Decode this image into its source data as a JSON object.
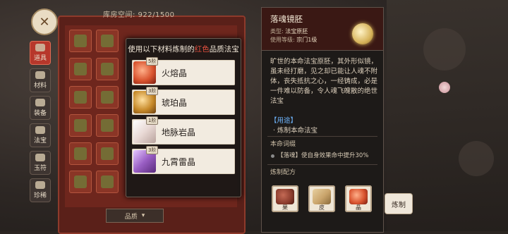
{
  "storage": {
    "label": "库房空间: 922/1500"
  },
  "nav": [
    {
      "label": "道具",
      "icon": "pouch-icon",
      "active": true
    },
    {
      "label": "材料",
      "icon": "ore-icon",
      "active": false
    },
    {
      "label": "装备",
      "icon": "armor-icon",
      "active": false
    },
    {
      "label": "法宝",
      "icon": "treasure-icon",
      "active": false
    },
    {
      "label": "玉符",
      "icon": "jade-talisman-icon",
      "active": false
    },
    {
      "label": "珍稀",
      "icon": "rare-gem-icon",
      "active": false
    }
  ],
  "bottom": {
    "quality": "品质"
  },
  "popup": {
    "title_prefix": "使用以下材料炼制的",
    "title_red": "红色",
    "title_suffix": "品质法宝",
    "materials": [
      {
        "name": "火熔晶",
        "tier": "5阶",
        "icon": "red-crystal-icon",
        "color": "#d9542f"
      },
      {
        "name": "琥珀晶",
        "tier": "3阶",
        "icon": "amber-crystal-icon",
        "color": "#c78a2a"
      },
      {
        "name": "地脉岩晶",
        "tier": "1阶",
        "icon": "rock-crystal-icon",
        "color": "#e8d8d4"
      },
      {
        "name": "九霄雷晶",
        "tier": "3阶",
        "icon": "thunder-crystal-icon",
        "color": "#9a5fc4"
      }
    ]
  },
  "detail": {
    "title": "落魂镜胚",
    "type_label": "类型:",
    "type_value": "法宝原胚",
    "level_label": "使用等级:",
    "level_value": "宗门1级",
    "icon": "mirror-embryo-icon",
    "description": "旷世的本命法宝原胚，其外形似镜，虽未经打磨，见之却已能让人魂不附体，丧失抵抗之心，一经铸成，必是一件难以防备，令人魂飞魄散的绝世法宝",
    "usage_header": "【用途】",
    "usage": "· 炼制本命法宝",
    "affix_header": "本命词缀",
    "affix": "【落魂】使自身效果命中提升30%",
    "recipe_header": "炼制配方",
    "recipe": [
      {
        "label": "果",
        "icon": "fruit-icon",
        "color": "#8a3b2c"
      },
      {
        "label": "皮",
        "icon": "hide-icon",
        "color": "#c9a46b"
      },
      {
        "label": "晶",
        "icon": "crystal-icon",
        "color": "#d9542f"
      }
    ],
    "craft_label": "炼制"
  },
  "colors": {
    "red_accent": "#e34f3f",
    "blue_accent": "#6fb6ff",
    "panel_bg": "#1d1a18"
  }
}
